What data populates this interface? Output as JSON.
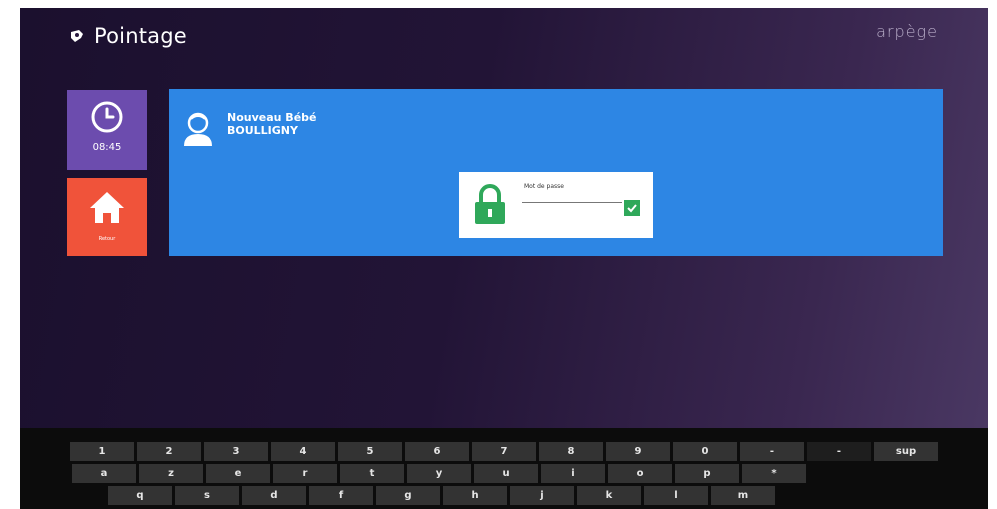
{
  "header": {
    "title": "Pointage",
    "brand": "arpège"
  },
  "tiles": {
    "clock_label": "08:45",
    "home_label": "Retour"
  },
  "child": {
    "first_name": "Nouveau Bébé",
    "last_name": "BOULLIGNY"
  },
  "lock": {
    "label": "Mot de passe",
    "value": ""
  },
  "keyboard": {
    "row1": [
      "1",
      "2",
      "3",
      "4",
      "5",
      "6",
      "7",
      "8",
      "9",
      "0",
      "-",
      "-",
      "sup"
    ],
    "row2": [
      "a",
      "z",
      "e",
      "r",
      "t",
      "y",
      "u",
      "i",
      "o",
      "p",
      "*"
    ],
    "row3": [
      "q",
      "s",
      "d",
      "f",
      "g",
      "h",
      "j",
      "k",
      "l",
      "m"
    ]
  },
  "colors": {
    "tile_clock": "#6c4cae",
    "tile_home": "#f0533a",
    "panel": "#2d86e4",
    "lock_green": "#2fa85a"
  }
}
